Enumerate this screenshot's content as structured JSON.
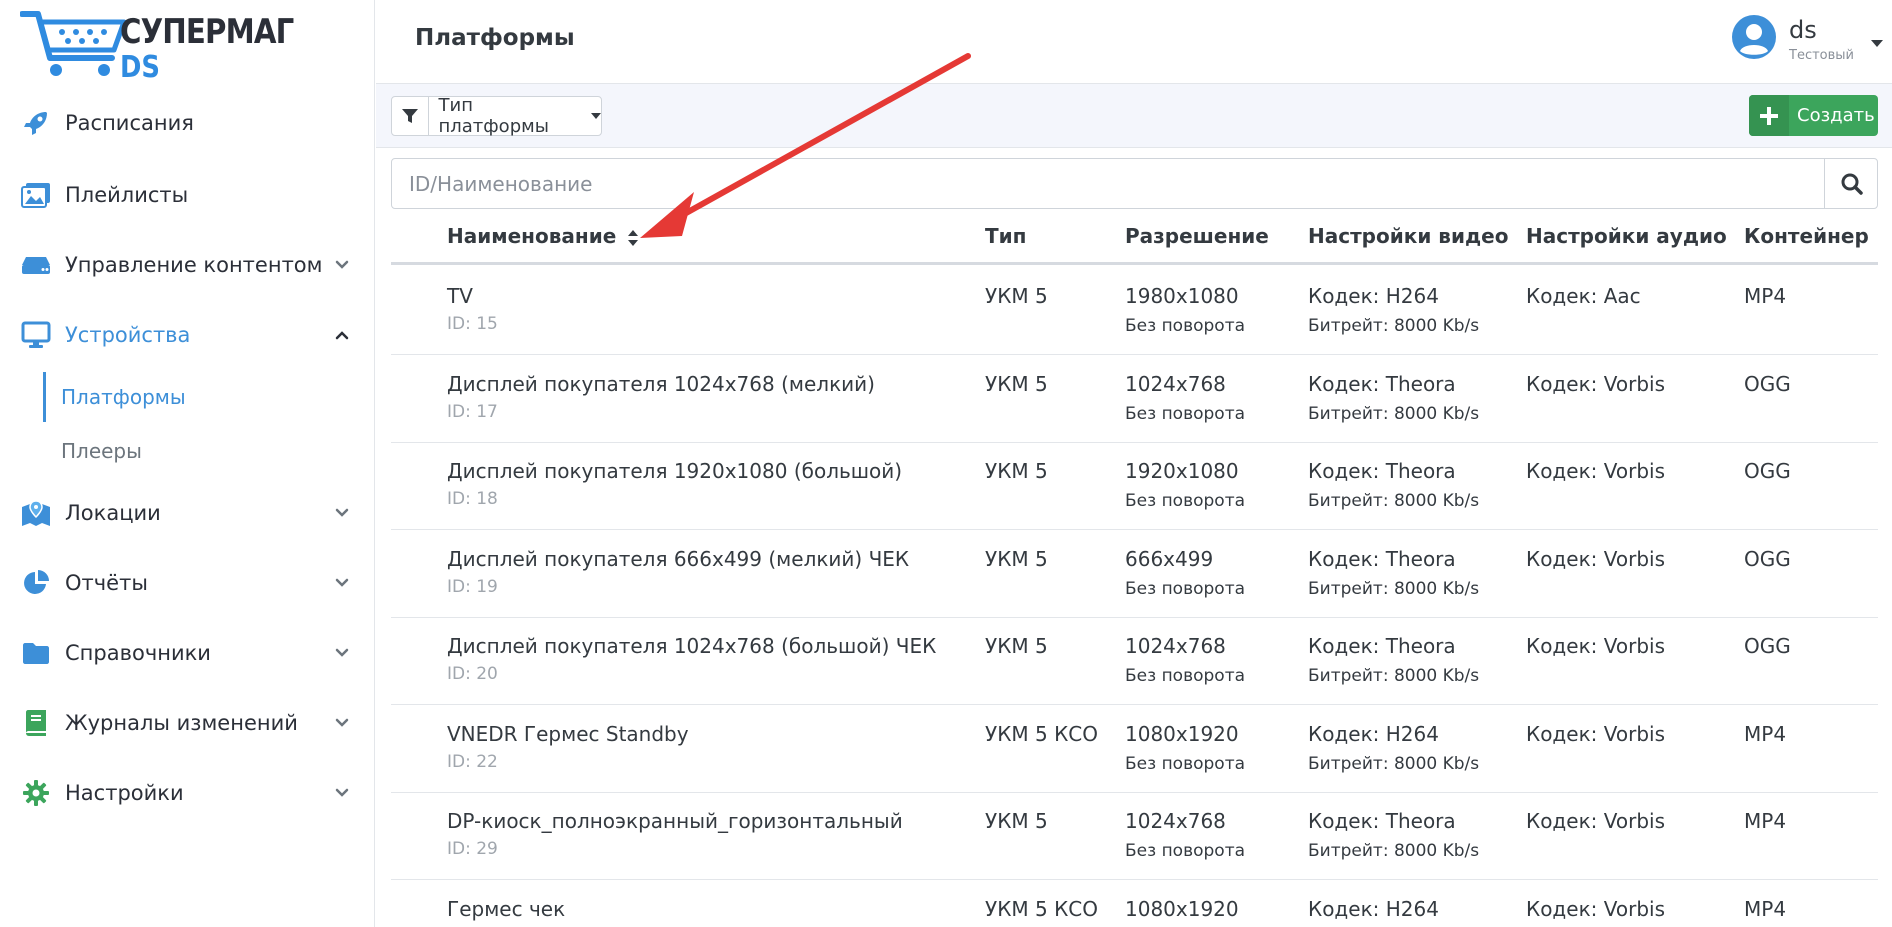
{
  "logo": {
    "line1": "СУПЕРМАГ",
    "line2": "DS"
  },
  "sidebar": {
    "items": [
      {
        "label": "Расписания",
        "icon": "rocket-icon",
        "has_chevron": false
      },
      {
        "label": "Плейлисты",
        "icon": "images-icon",
        "has_chevron": false
      },
      {
        "label": "Управление контентом",
        "icon": "hdd-icon",
        "has_chevron": true
      },
      {
        "label": "Устройства",
        "icon": "monitor-icon",
        "has_chevron": true,
        "expanded": true
      },
      {
        "label": "Локации",
        "icon": "map-icon",
        "has_chevron": true
      },
      {
        "label": "Отчёты",
        "icon": "pie-chart-icon",
        "has_chevron": true
      },
      {
        "label": "Справочники",
        "icon": "folder-icon",
        "has_chevron": true
      },
      {
        "label": "Журналы изменений",
        "icon": "book-icon",
        "has_chevron": true
      },
      {
        "label": "Настройки",
        "icon": "gear-icon",
        "has_chevron": true
      }
    ],
    "subitems": [
      {
        "label": "Платформы",
        "active": true
      },
      {
        "label": "Плееры",
        "active": false
      }
    ]
  },
  "header": {
    "title": "Платформы",
    "user_name": "ds",
    "user_role": "Тестовый"
  },
  "toolbar": {
    "filter_label": "Тип платформы",
    "create_label": "Создать"
  },
  "search": {
    "placeholder": "ID/Наименование"
  },
  "table": {
    "columns": [
      "Наименование",
      "Тип",
      "Разрешение",
      "Настройки видео",
      "Настройки аудио",
      "Контейнер"
    ],
    "rows": [
      {
        "name": "TV",
        "id": "ID: 15",
        "type": "УКМ 5",
        "resolution": "1980x1080",
        "rotation": "Без поворота",
        "codec": "Кодек: H264",
        "bitrate": "Битрейт: 8000 Kb/s",
        "audio": "Кодек: Aac",
        "container": "MP4"
      },
      {
        "name": "Дисплей покупателя 1024x768 (мелкий)",
        "id": "ID: 17",
        "type": "УКМ 5",
        "resolution": "1024x768",
        "rotation": "Без поворота",
        "codec": "Кодек: Theora",
        "bitrate": "Битрейт: 8000 Kb/s",
        "audio": "Кодек: Vorbis",
        "container": "OGG"
      },
      {
        "name": "Дисплей покупателя 1920x1080 (большой)",
        "id": "ID: 18",
        "type": "УКМ 5",
        "resolution": "1920x1080",
        "rotation": "Без поворота",
        "codec": "Кодек: Theora",
        "bitrate": "Битрейт: 8000 Kb/s",
        "audio": "Кодек: Vorbis",
        "container": "OGG"
      },
      {
        "name": "Дисплей покупателя 666x499 (мелкий) ЧЕК",
        "id": "ID: 19",
        "type": "УКМ 5",
        "resolution": "666x499",
        "rotation": "Без поворота",
        "codec": "Кодек: Theora",
        "bitrate": "Битрейт: 8000 Kb/s",
        "audio": "Кодек: Vorbis",
        "container": "OGG"
      },
      {
        "name": "Дисплей покупателя 1024x768 (большой) ЧЕК",
        "id": "ID: 20",
        "type": "УКМ 5",
        "resolution": "1024x768",
        "rotation": "Без поворота",
        "codec": "Кодек: Theora",
        "bitrate": "Битрейт: 8000 Kb/s",
        "audio": "Кодек: Vorbis",
        "container": "OGG"
      },
      {
        "name": "VNEDR Гермес Standby",
        "id": "ID: 22",
        "type": "УКМ 5 КСО",
        "resolution": "1080x1920",
        "rotation": "Без поворота",
        "codec": "Кодек: H264",
        "bitrate": "Битрейт: 8000 Kb/s",
        "audio": "Кодек: Vorbis",
        "container": "MP4"
      },
      {
        "name": "DP-киоск_полноэкранный_горизонтальный",
        "id": "ID: 29",
        "type": "УКМ 5",
        "resolution": "1024x768",
        "rotation": "Без поворота",
        "codec": "Кодек: Theora",
        "bitrate": "Битрейт: 8000 Kb/s",
        "audio": "Кодек: Vorbis",
        "container": "MP4"
      },
      {
        "name": "Гермес чек",
        "id": "",
        "type": "УКМ 5 КСО",
        "resolution": "1080x1920",
        "rotation": "",
        "codec": "Кодек: H264",
        "bitrate": "",
        "audio": "Кодек: Vorbis",
        "container": "MP4"
      }
    ]
  },
  "colors": {
    "accent": "#3d8fd8",
    "create": "#3ca55c",
    "arrow": "#e53935"
  }
}
